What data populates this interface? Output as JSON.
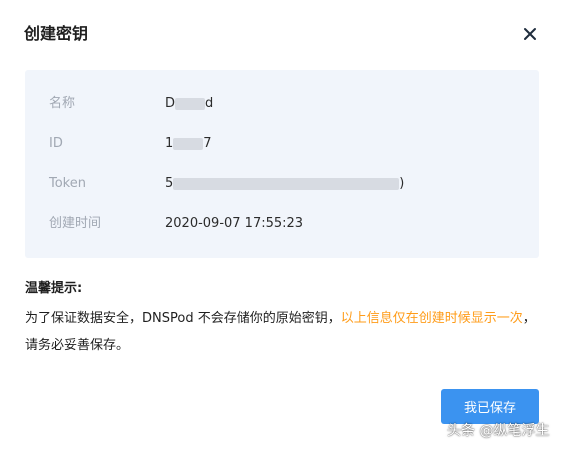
{
  "dialog": {
    "title": "创建密钥",
    "close_icon": "close-icon"
  },
  "key_info": {
    "name_label": "名称",
    "name_value_start": "D",
    "name_value_end": "d",
    "id_label": "ID",
    "id_value_start": "1",
    "id_value_end": "7",
    "token_label": "Token",
    "token_value_start": "5",
    "token_value_end": ")",
    "created_label": "创建时间",
    "created_value": "2020-09-07 17:55:23"
  },
  "tips": {
    "title": "温馨提示:",
    "text_normal": "为了保证数据安全，DNSPod 不会存储你的原始密钥，",
    "text_warning": "以上信息仅在创建时候显示一次",
    "text_end": "，请务必妥善保存。",
    "warning_color": "#ff9c19"
  },
  "footer": {
    "save_label": "我已保存",
    "accent_color": "#3b93f0"
  },
  "watermark": {
    "text": "头条 @纵笔浮生"
  }
}
